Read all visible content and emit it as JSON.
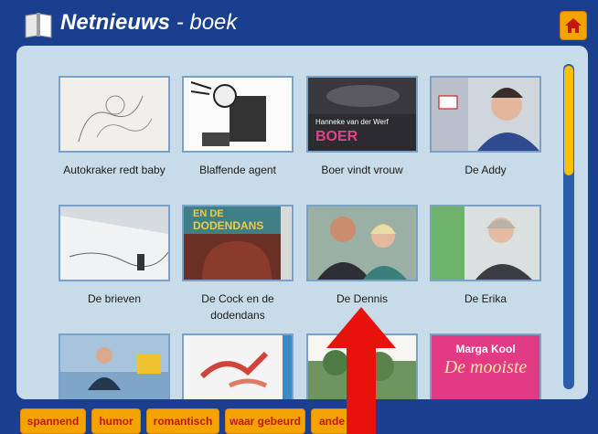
{
  "header": {
    "app_name": "Netnieuws",
    "section": "- boek",
    "colors": {
      "header_bg": "#1b3f8f",
      "panel_bg": "#c8dbe8",
      "accent": "#f5a300"
    }
  },
  "home_button": {
    "icon": "home-icon"
  },
  "books": [
    {
      "title": "Autokraker redt baby"
    },
    {
      "title": "Blaffende agent"
    },
    {
      "title": "Boer vindt vrouw",
      "cover_text": [
        "Hanneke van der Werf",
        "BOER"
      ]
    },
    {
      "title": "De Addy"
    },
    {
      "title": "De brieven"
    },
    {
      "title": "De Cock en de dodendans",
      "cover_text": [
        "EN DE",
        "DODENDANS"
      ]
    },
    {
      "title": "De Dennis"
    },
    {
      "title": "De Erika"
    },
    {
      "title": ""
    },
    {
      "title": ""
    },
    {
      "title": ""
    },
    {
      "title": "",
      "cover_text": [
        "Marga Kool",
        "De mooiste"
      ]
    }
  ],
  "filters": [
    "spannend",
    "humor",
    "romantisch",
    "waar gebeurd",
    "ande"
  ]
}
